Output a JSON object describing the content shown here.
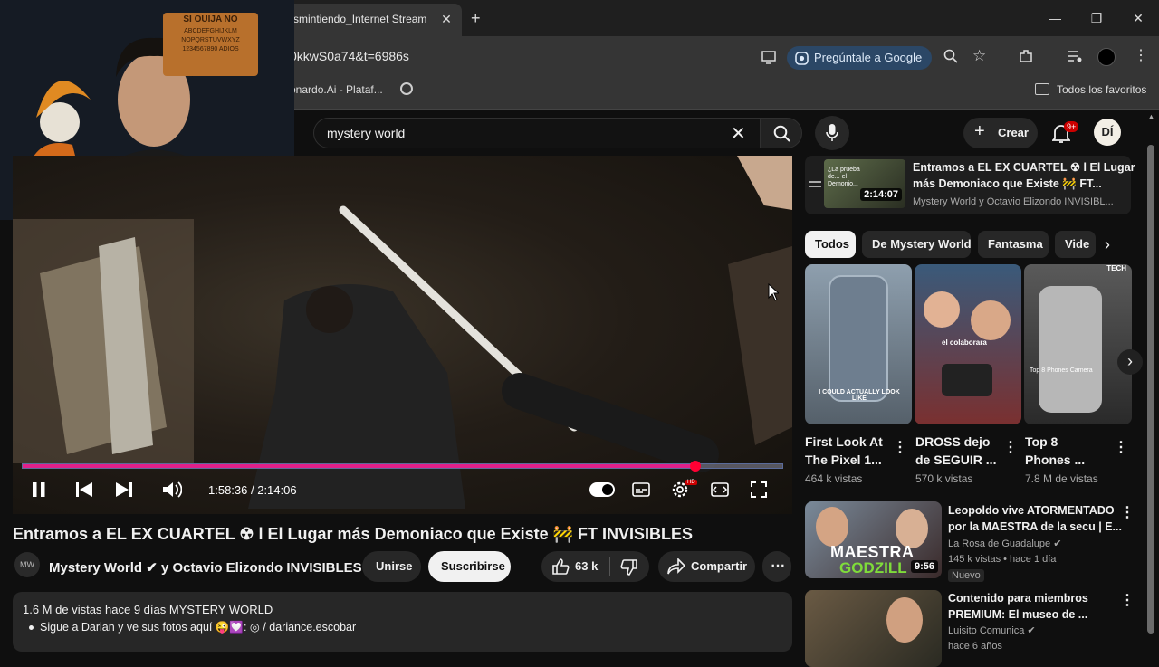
{
  "browser": {
    "tab_title": "smintiendo_Internet Stream",
    "url": "0kkwS0a74&t=6986s",
    "google_pill": "Pregúntale a Google",
    "bookmark_1": "onardo.Ai - Plataf...",
    "all_bookmarks": "Todos los favoritos"
  },
  "webcam": {
    "ouija_title": "SI OUIJA NO",
    "ouija_letters": "ABCDEFGHIJKLM NOPQRSTUVWXYZ 1234567890 ADIOS"
  },
  "youtube": {
    "search_value": "mystery world",
    "create_label": "Crear",
    "notif_count": "9+",
    "avatar_initials": "DÍ"
  },
  "player": {
    "time": "1:58:36 / 2:14:06",
    "progress_fraction": 0.885
  },
  "video": {
    "title": "Entramos a EL EX CUARTEL ☢ l El Lugar más Demoniaco que Existe 🚧 FT INVISIBLES",
    "channel_avatar": "MW",
    "channel": "Mystery World ✔ y Octavio Elizondo INVISIBLES ✔",
    "join": "Unirse",
    "subscribe": "Suscribirse",
    "likes": "63 k",
    "share": "Compartir",
    "desc_meta": "1.6 M de vistas  hace 9 días  MYSTERY WORLD",
    "desc_line": "Sigue a Darian y ve sus fotos aquí 😜💟:  ◎ / dariance.escobar"
  },
  "miniplayer": {
    "title_1": "Entramos a EL EX CUARTEL ☢ l El Lugar",
    "title_2": "más Demoniaco que Existe 🚧 FT...",
    "channel": "Mystery World y Octavio Elizondo INVISIBL...",
    "duration": "2:14:07",
    "thumb_text": "¿La prueba de... el Demonio..."
  },
  "chips": [
    "Todos",
    "De Mystery World",
    "Fantasma",
    "Vide"
  ],
  "shorts": [
    {
      "line1": "First Look At",
      "line2": "The Pixel 1...",
      "views": "464 k vistas",
      "overlay": "I COULD ACTUALLY LOOK LIKE"
    },
    {
      "line1": "DROSS dejo",
      "line2": "de SEGUIR ...",
      "views": "570 k vistas",
      "overlay": "el colaborara"
    },
    {
      "line1": "Top 8",
      "line2": "Phones ...",
      "views": "7.8 M de vistas",
      "overlay": "Top 8 Phones Camera",
      "badge": "TECH"
    }
  ],
  "recs": [
    {
      "title1": "Leopoldo vive ATORMENTADO",
      "title2": "por la MAESTRA de la secu | E...",
      "channel": "La Rosa de Guadalupe ✔",
      "meta": "145 k vistas • hace 1 día",
      "badge": "Nuevo",
      "duration": "9:56",
      "thumb_text": "MAESTRA",
      "thumb_text2": "GODZILL"
    },
    {
      "title1": "Contenido para miembros",
      "title2": "PREMIUM: El museo de ...",
      "channel": "Luisito Comunica ✔",
      "meta": "hace 6 años"
    }
  ],
  "colors": {
    "accent": "#ff0033",
    "progress": "#e0208a",
    "pill_blue": "#2b4766"
  }
}
